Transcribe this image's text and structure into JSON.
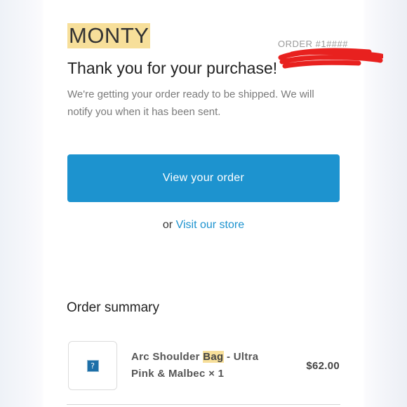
{
  "shop": {
    "store_name": "MONTY",
    "order_number": "ORDER #1####",
    "heading": "Thank you for your purchase!",
    "message": "We're getting your order ready to be shipped. We will notify you when it has been sent."
  },
  "actions": {
    "view_order_label": "View your order",
    "or_text": "or",
    "visit_store_label": "Visit our store"
  },
  "summary": {
    "title": "Order summary",
    "items": [
      {
        "name_before": "Arc Shoulder ",
        "name_highlight": "Bag",
        "name_after": " - Ultra Pink & Malbec × 1",
        "price": "$62.00",
        "image_icon": "?"
      }
    ]
  },
  "colors": {
    "accent": "#1d93cf",
    "highlight": "#f7df9a",
    "redaction": "#e8211f"
  }
}
